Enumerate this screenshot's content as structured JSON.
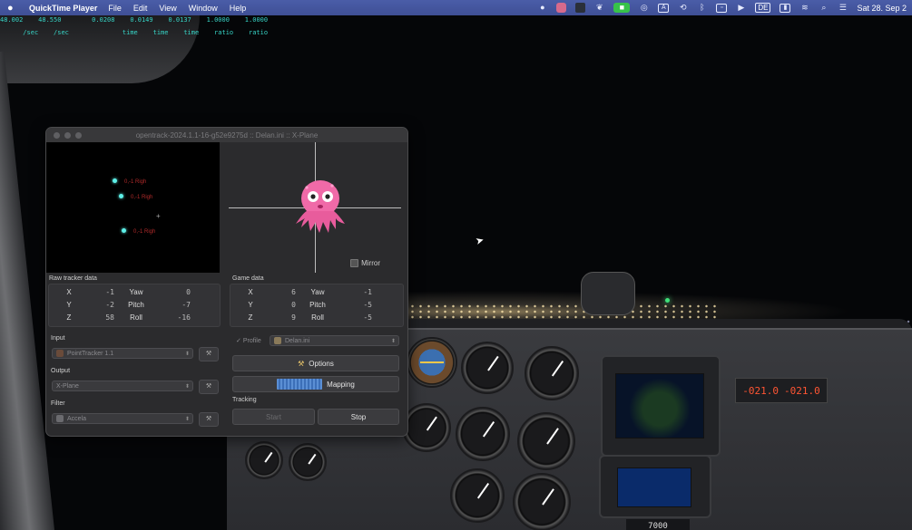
{
  "menubar": {
    "app_name": "QuickTime Player",
    "menus": [
      "File",
      "Edit",
      "View",
      "Window",
      "Help"
    ],
    "input_source": "DE",
    "clock": "Sat 28. Sep 2"
  },
  "hud": {
    "values": [
      "48.002",
      "48.550",
      "0.0208",
      "0.0149",
      "0.0137",
      "1.0000",
      "1.0000"
    ],
    "units": [
      "/sec",
      "/sec",
      "time",
      "time",
      "time",
      "ratio",
      "ratio"
    ]
  },
  "cockpit": {
    "transponder_left": "-021.0",
    "transponder_right": "-021.0",
    "squawk": "7000"
  },
  "opentrack": {
    "title": "opentrack-2024.1.1-16-g52e9275d :: Delan.ini :: X-Plane",
    "tracker_points": [
      "0,-1 Righ",
      "0,-1 Righ",
      "0,-1 Righ"
    ],
    "mirror_label": "Mirror",
    "raw_tracker": {
      "title": "Raw tracker data",
      "rows": [
        {
          "axis": "X",
          "axis_value": "-1",
          "rot": "Yaw",
          "rot_value": "0"
        },
        {
          "axis": "Y",
          "axis_value": "-2",
          "rot": "Pitch",
          "rot_value": "-7"
        },
        {
          "axis": "Z",
          "axis_value": "58",
          "rot": "Roll",
          "rot_value": "-16"
        }
      ]
    },
    "game_data": {
      "title": "Game data",
      "rows": [
        {
          "axis": "X",
          "axis_value": "6",
          "rot": "Yaw",
          "rot_value": "-1"
        },
        {
          "axis": "Y",
          "axis_value": "0",
          "rot": "Pitch",
          "rot_value": "-5"
        },
        {
          "axis": "Z",
          "axis_value": "9",
          "rot": "Roll",
          "rot_value": "-5"
        }
      ]
    },
    "input": {
      "label": "Input",
      "value": "PointTracker 1.1"
    },
    "output": {
      "label": "Output",
      "value": "X-Plane"
    },
    "filter": {
      "label": "Filter",
      "value": "Accela"
    },
    "profile": {
      "label": "Profile",
      "value": "Delan.ini"
    },
    "options_label": "Options",
    "mapping_label": "Mapping",
    "tracking": {
      "label": "Tracking",
      "start_label": "Start",
      "stop_label": "Stop"
    }
  }
}
